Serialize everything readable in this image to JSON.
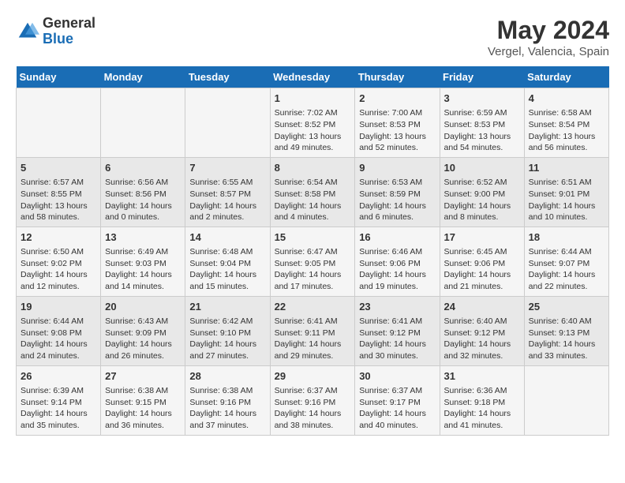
{
  "header": {
    "logo_general": "General",
    "logo_blue": "Blue",
    "month_year": "May 2024",
    "location": "Vergel, Valencia, Spain"
  },
  "days_of_week": [
    "Sunday",
    "Monday",
    "Tuesday",
    "Wednesday",
    "Thursday",
    "Friday",
    "Saturday"
  ],
  "weeks": [
    [
      {
        "day": "",
        "info": ""
      },
      {
        "day": "",
        "info": ""
      },
      {
        "day": "",
        "info": ""
      },
      {
        "day": "1",
        "info": "Sunrise: 7:02 AM\nSunset: 8:52 PM\nDaylight: 13 hours and 49 minutes."
      },
      {
        "day": "2",
        "info": "Sunrise: 7:00 AM\nSunset: 8:53 PM\nDaylight: 13 hours and 52 minutes."
      },
      {
        "day": "3",
        "info": "Sunrise: 6:59 AM\nSunset: 8:53 PM\nDaylight: 13 hours and 54 minutes."
      },
      {
        "day": "4",
        "info": "Sunrise: 6:58 AM\nSunset: 8:54 PM\nDaylight: 13 hours and 56 minutes."
      }
    ],
    [
      {
        "day": "5",
        "info": "Sunrise: 6:57 AM\nSunset: 8:55 PM\nDaylight: 13 hours and 58 minutes."
      },
      {
        "day": "6",
        "info": "Sunrise: 6:56 AM\nSunset: 8:56 PM\nDaylight: 14 hours and 0 minutes."
      },
      {
        "day": "7",
        "info": "Sunrise: 6:55 AM\nSunset: 8:57 PM\nDaylight: 14 hours and 2 minutes."
      },
      {
        "day": "8",
        "info": "Sunrise: 6:54 AM\nSunset: 8:58 PM\nDaylight: 14 hours and 4 minutes."
      },
      {
        "day": "9",
        "info": "Sunrise: 6:53 AM\nSunset: 8:59 PM\nDaylight: 14 hours and 6 minutes."
      },
      {
        "day": "10",
        "info": "Sunrise: 6:52 AM\nSunset: 9:00 PM\nDaylight: 14 hours and 8 minutes."
      },
      {
        "day": "11",
        "info": "Sunrise: 6:51 AM\nSunset: 9:01 PM\nDaylight: 14 hours and 10 minutes."
      }
    ],
    [
      {
        "day": "12",
        "info": "Sunrise: 6:50 AM\nSunset: 9:02 PM\nDaylight: 14 hours and 12 minutes."
      },
      {
        "day": "13",
        "info": "Sunrise: 6:49 AM\nSunset: 9:03 PM\nDaylight: 14 hours and 14 minutes."
      },
      {
        "day": "14",
        "info": "Sunrise: 6:48 AM\nSunset: 9:04 PM\nDaylight: 14 hours and 15 minutes."
      },
      {
        "day": "15",
        "info": "Sunrise: 6:47 AM\nSunset: 9:05 PM\nDaylight: 14 hours and 17 minutes."
      },
      {
        "day": "16",
        "info": "Sunrise: 6:46 AM\nSunset: 9:06 PM\nDaylight: 14 hours and 19 minutes."
      },
      {
        "day": "17",
        "info": "Sunrise: 6:45 AM\nSunset: 9:06 PM\nDaylight: 14 hours and 21 minutes."
      },
      {
        "day": "18",
        "info": "Sunrise: 6:44 AM\nSunset: 9:07 PM\nDaylight: 14 hours and 22 minutes."
      }
    ],
    [
      {
        "day": "19",
        "info": "Sunrise: 6:44 AM\nSunset: 9:08 PM\nDaylight: 14 hours and 24 minutes."
      },
      {
        "day": "20",
        "info": "Sunrise: 6:43 AM\nSunset: 9:09 PM\nDaylight: 14 hours and 26 minutes."
      },
      {
        "day": "21",
        "info": "Sunrise: 6:42 AM\nSunset: 9:10 PM\nDaylight: 14 hours and 27 minutes."
      },
      {
        "day": "22",
        "info": "Sunrise: 6:41 AM\nSunset: 9:11 PM\nDaylight: 14 hours and 29 minutes."
      },
      {
        "day": "23",
        "info": "Sunrise: 6:41 AM\nSunset: 9:12 PM\nDaylight: 14 hours and 30 minutes."
      },
      {
        "day": "24",
        "info": "Sunrise: 6:40 AM\nSunset: 9:12 PM\nDaylight: 14 hours and 32 minutes."
      },
      {
        "day": "25",
        "info": "Sunrise: 6:40 AM\nSunset: 9:13 PM\nDaylight: 14 hours and 33 minutes."
      }
    ],
    [
      {
        "day": "26",
        "info": "Sunrise: 6:39 AM\nSunset: 9:14 PM\nDaylight: 14 hours and 35 minutes."
      },
      {
        "day": "27",
        "info": "Sunrise: 6:38 AM\nSunset: 9:15 PM\nDaylight: 14 hours and 36 minutes."
      },
      {
        "day": "28",
        "info": "Sunrise: 6:38 AM\nSunset: 9:16 PM\nDaylight: 14 hours and 37 minutes."
      },
      {
        "day": "29",
        "info": "Sunrise: 6:37 AM\nSunset: 9:16 PM\nDaylight: 14 hours and 38 minutes."
      },
      {
        "day": "30",
        "info": "Sunrise: 6:37 AM\nSunset: 9:17 PM\nDaylight: 14 hours and 40 minutes."
      },
      {
        "day": "31",
        "info": "Sunrise: 6:36 AM\nSunset: 9:18 PM\nDaylight: 14 hours and 41 minutes."
      },
      {
        "day": "",
        "info": ""
      }
    ]
  ]
}
